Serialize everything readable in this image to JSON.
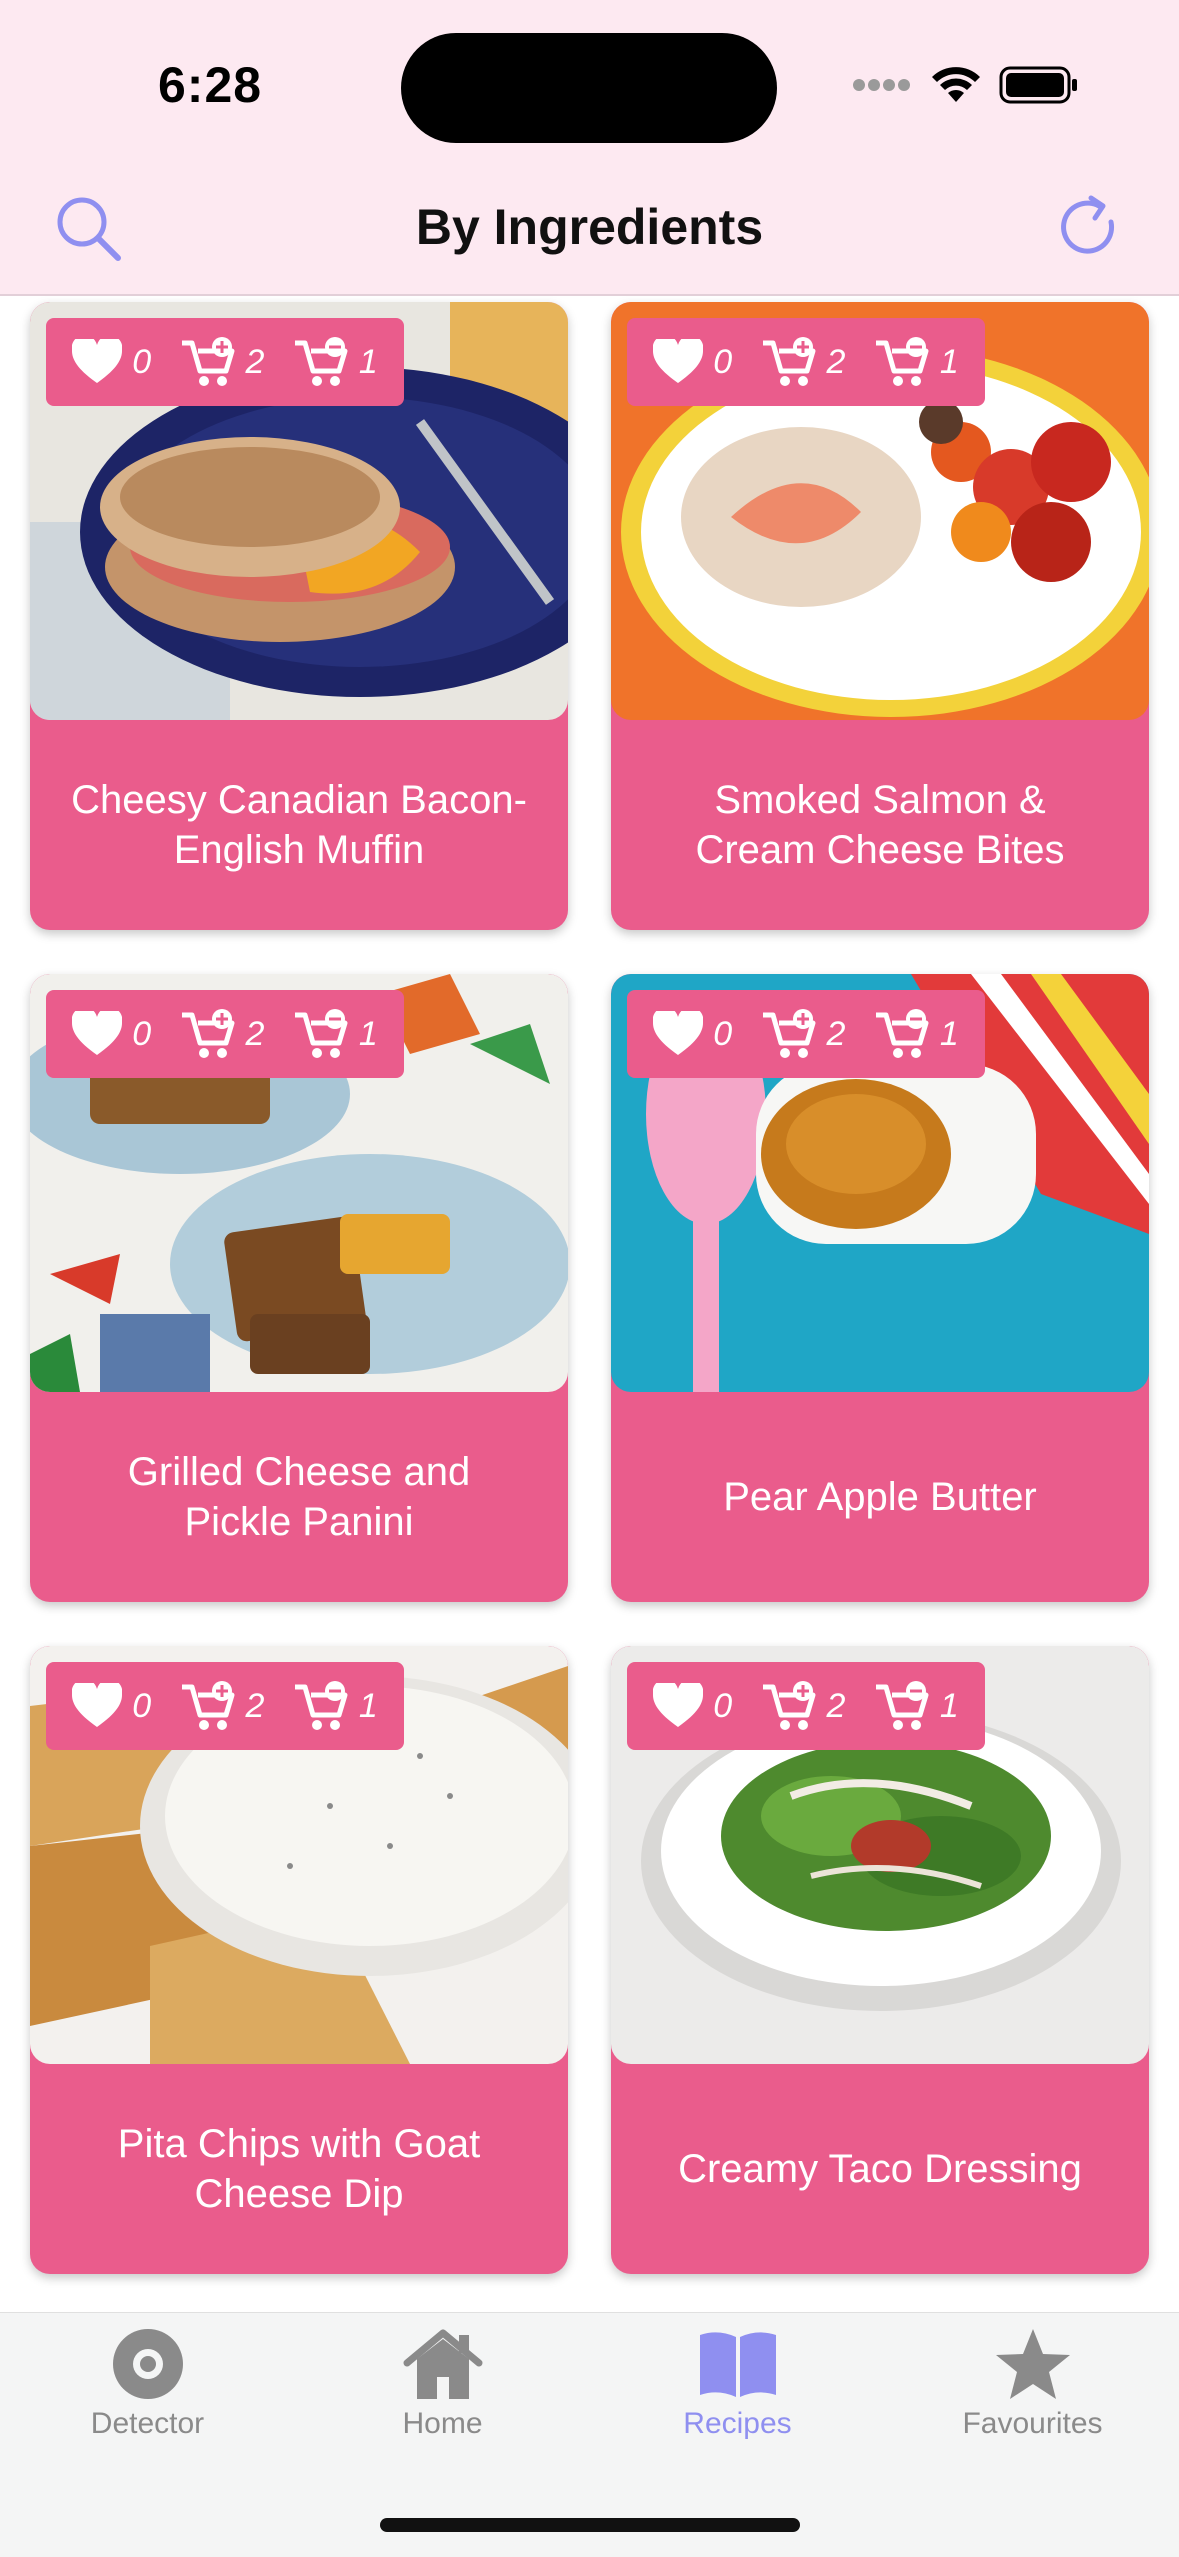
{
  "status": {
    "time": "6:28"
  },
  "header": {
    "title": "By Ingredients"
  },
  "stats": {
    "likes": "0",
    "add_count": "2",
    "remove_count": "1"
  },
  "recipes": [
    {
      "title": "Cheesy Canadian Bacon-English Muffin"
    },
    {
      "title": "Smoked Salmon & Cream Cheese Bites"
    },
    {
      "title": "Grilled Cheese and Pickle Panini"
    },
    {
      "title": "Pear Apple Butter"
    },
    {
      "title": "Pita Chips with Goat Cheese Dip"
    },
    {
      "title": "Creamy Taco Dressing"
    }
  ],
  "tabs": [
    {
      "label": "Detector",
      "icon": "detector-icon"
    },
    {
      "label": "Home",
      "icon": "home-icon"
    },
    {
      "label": "Recipes",
      "icon": "book-icon",
      "active": true
    },
    {
      "label": "Favourites",
      "icon": "star-icon"
    }
  ],
  "colors": {
    "card": "#ea5c8c",
    "accent": "#8f8ff0",
    "header_bg": "#fde9f1"
  }
}
